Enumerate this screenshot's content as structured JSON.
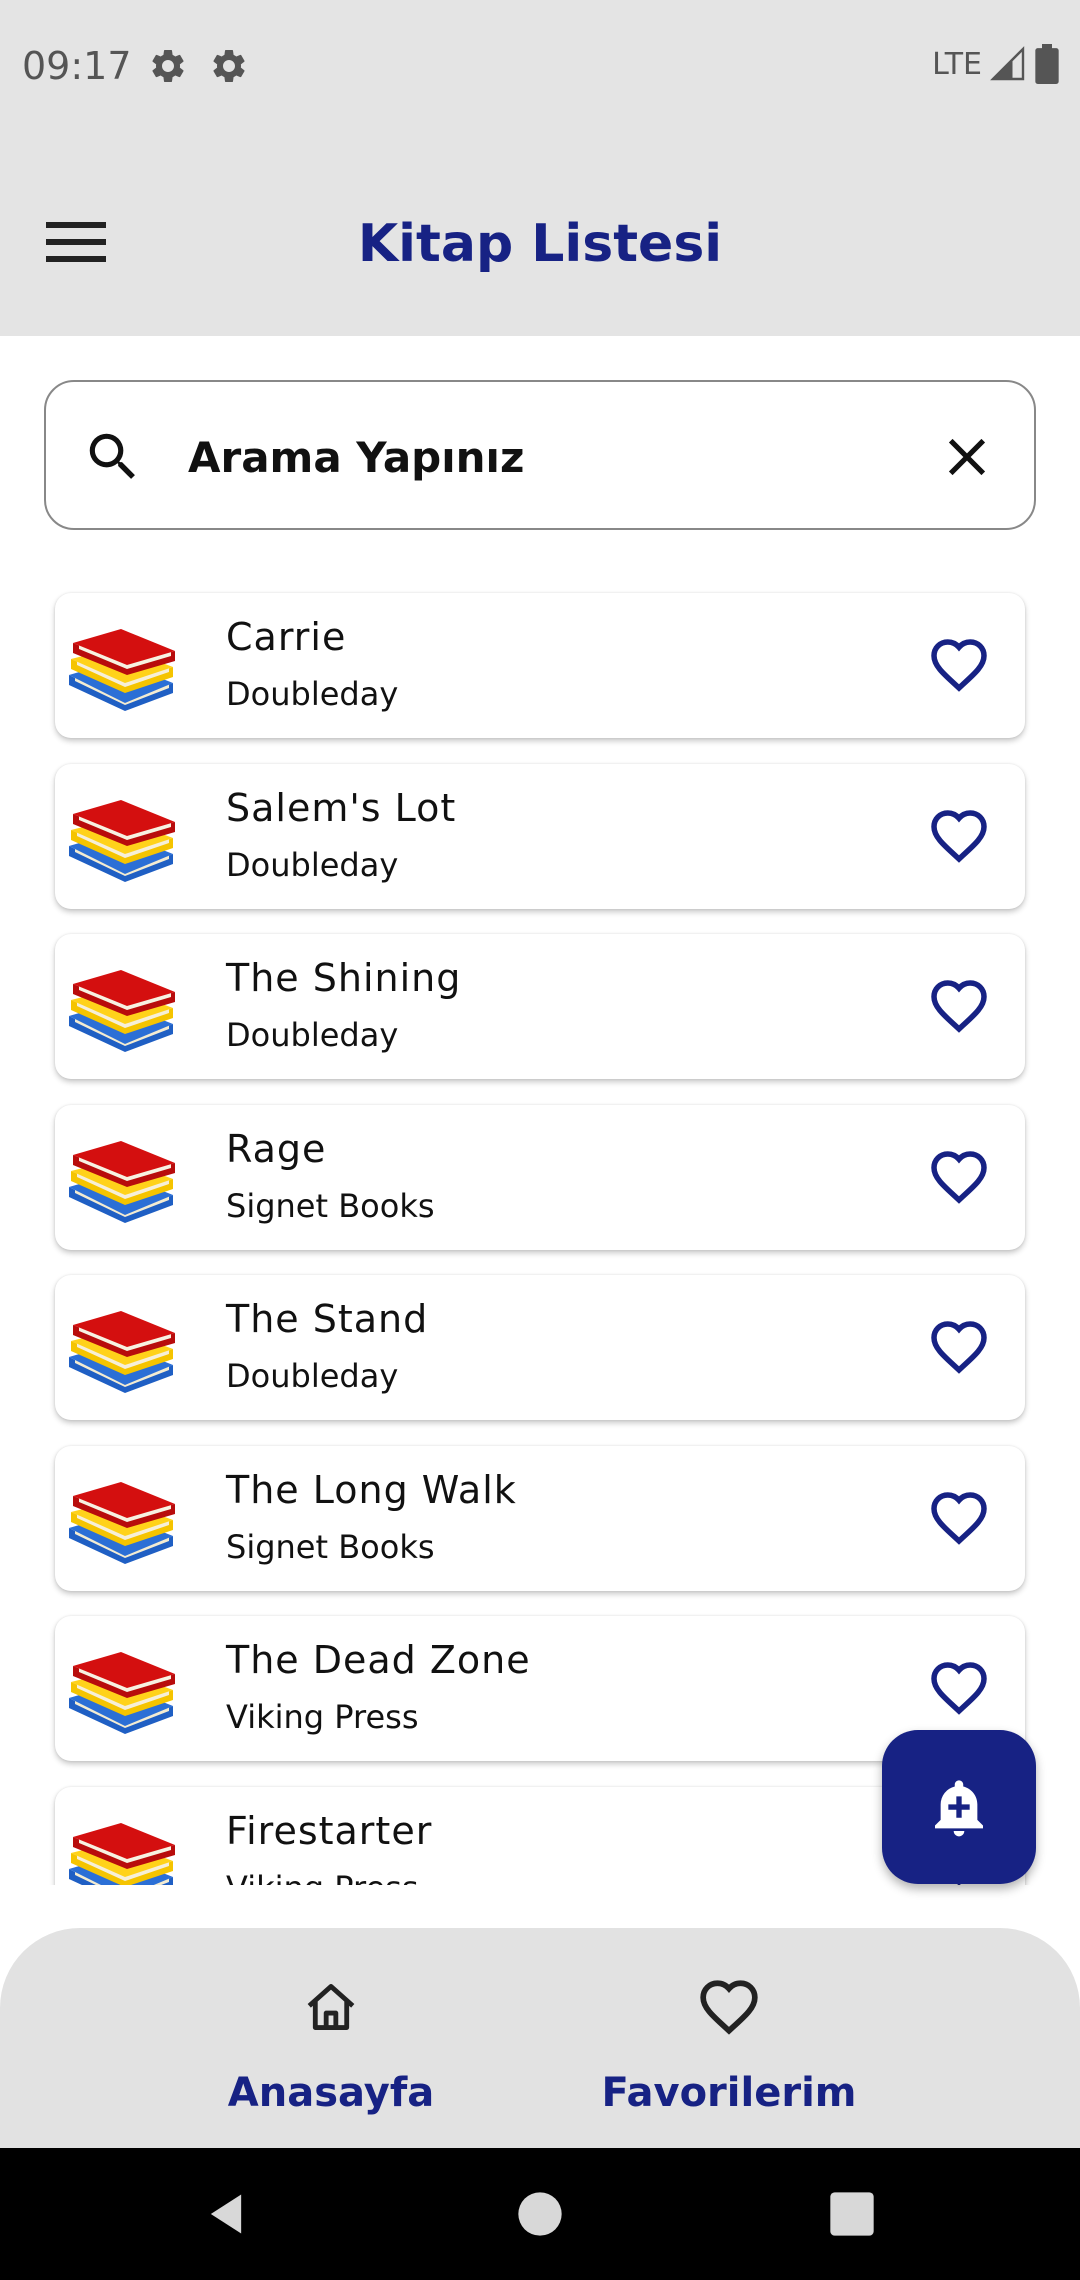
{
  "status_bar": {
    "time": "09:17",
    "network": "LTE",
    "icons": [
      "gear-icon",
      "gear-icon",
      "signal-icon",
      "battery-icon"
    ]
  },
  "app_bar": {
    "title": "Kitap Listesi",
    "menu_icon": "hamburger-icon"
  },
  "search": {
    "placeholder": "Arama Yapınız",
    "value": "",
    "search_icon": "search-icon",
    "clear_icon": "close-icon"
  },
  "books": [
    {
      "title": "Carrie",
      "publisher": "Doubleday"
    },
    {
      "title": "Salem's Lot",
      "publisher": "Doubleday"
    },
    {
      "title": "The Shining",
      "publisher": "Doubleday"
    },
    {
      "title": "Rage",
      "publisher": "Signet Books"
    },
    {
      "title": "The Stand",
      "publisher": "Doubleday"
    },
    {
      "title": "The Long Walk",
      "publisher": "Signet Books"
    },
    {
      "title": "The Dead Zone",
      "publisher": "Viking Press"
    },
    {
      "title": "Firestarter",
      "publisher": "Viking Press"
    }
  ],
  "fab": {
    "icon": "add-alert-icon"
  },
  "bottom_nav": {
    "items": [
      {
        "label": "Anasayfa",
        "icon": "home-icon"
      },
      {
        "label": "Favorilerim",
        "icon": "heart-icon"
      }
    ]
  },
  "system_nav": {
    "icons": [
      "back-icon",
      "home-circle-icon",
      "recents-icon"
    ]
  },
  "colors": {
    "primary": "#172284",
    "app_bar_bg": "#e4e4e4",
    "bottom_nav_bg": "#e2e2e2",
    "book_red": "#d40f0f",
    "book_yellow": "#f5c400",
    "book_blue": "#1f5fc4"
  }
}
